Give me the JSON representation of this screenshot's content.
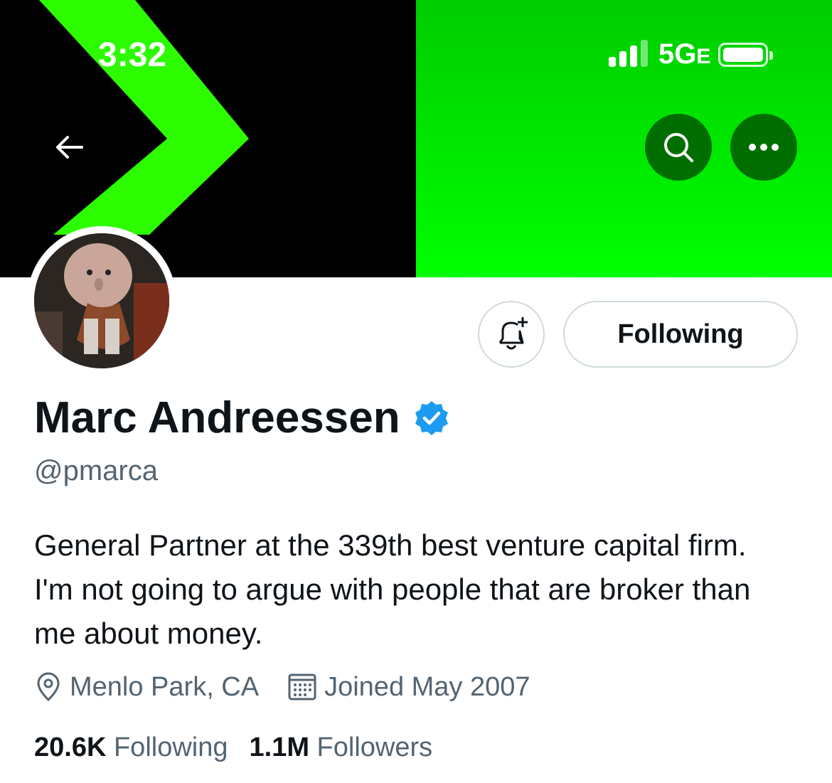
{
  "status_bar": {
    "time": "3:32",
    "network": "5G",
    "network_suffix": "E"
  },
  "banner": {
    "colors": {
      "left": "#000000",
      "right": "#00ff00",
      "chevron": "#2dfc00"
    }
  },
  "actions": {
    "follow_button": "Following"
  },
  "profile": {
    "name": "Marc Andreessen",
    "handle": "@pmarca",
    "bio": "General Partner at the 339th best venture capital firm. I'm not going to argue with people that are broker than me about money.",
    "location": "Menlo Park, CA",
    "joined": "Joined May 2007"
  },
  "stats": {
    "following_count": "20.6K",
    "following_label": "Following",
    "followers_count": "1.1M",
    "followers_label": "Followers"
  },
  "icons": [
    "back-arrow-icon",
    "search-icon",
    "more-icon",
    "bell-plus-icon",
    "verified-badge-icon",
    "location-icon",
    "calendar-icon"
  ]
}
